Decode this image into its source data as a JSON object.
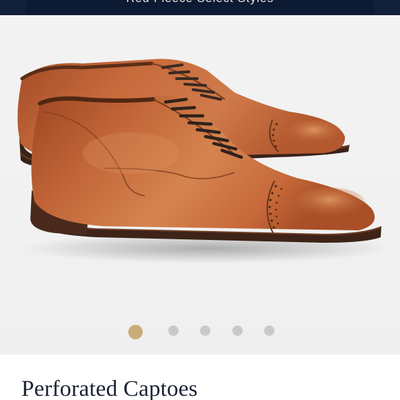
{
  "promo_banner": {
    "text": "Red Fleece Select Styles"
  },
  "carousel": {
    "image_alt": "Perforated Captoes",
    "slide_count": 5,
    "active_slide": 1,
    "colors": {
      "active_dot": "#c8ad78",
      "inactive_dot": "#c9c9c9",
      "leather": "#b85d33"
    }
  },
  "product": {
    "title": "Perforated Captoes"
  },
  "colors": {
    "banner": "#11203b",
    "title_text": "#1b2233"
  }
}
